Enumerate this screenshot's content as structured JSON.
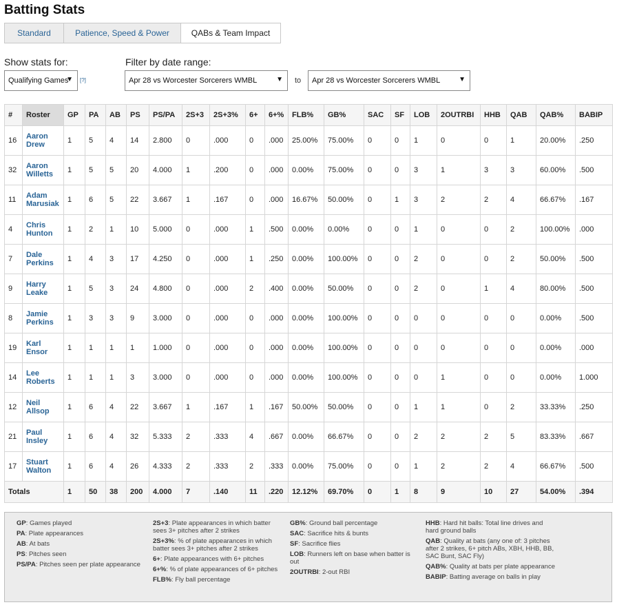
{
  "page_title": "Batting Stats",
  "tabs": [
    {
      "label": "Standard",
      "active": false
    },
    {
      "label": "Patience, Speed & Power",
      "active": false
    },
    {
      "label": "QABs & Team Impact",
      "active": true
    }
  ],
  "filters": {
    "show_stats_label": "Show stats for:",
    "show_stats_value": "Qualifying Games",
    "help_link": "[?]",
    "date_range_label": "Filter by date range:",
    "date_from": "Apr 28 vs Worcester Sorcerers WMBL",
    "to_label": "to",
    "date_to": "Apr 28 vs Worcester Sorcerers WMBL"
  },
  "table": {
    "headers": [
      "#",
      "Roster",
      "GP",
      "PA",
      "AB",
      "PS",
      "PS/PA",
      "2S+3",
      "2S+3%",
      "6+",
      "6+%",
      "FLB%",
      "GB%",
      "SAC",
      "SF",
      "LOB",
      "2OUTRBI",
      "HHB",
      "QAB",
      "QAB%",
      "BABIP"
    ],
    "rows": [
      {
        "num": "16",
        "first": "Aaron",
        "last": "Drew",
        "stats": [
          "1",
          "5",
          "4",
          "14",
          "2.800",
          "0",
          ".000",
          "0",
          ".000",
          "25.00%",
          "75.00%",
          "0",
          "0",
          "1",
          "0",
          "0",
          "1",
          "20.00%",
          ".250"
        ]
      },
      {
        "num": "32",
        "first": "Aaron",
        "last": "Willetts",
        "stats": [
          "1",
          "5",
          "5",
          "20",
          "4.000",
          "1",
          ".200",
          "0",
          ".000",
          "0.00%",
          "75.00%",
          "0",
          "0",
          "3",
          "1",
          "3",
          "3",
          "60.00%",
          ".500"
        ]
      },
      {
        "num": "11",
        "first": "Adam",
        "last": "Marusiak",
        "stats": [
          "1",
          "6",
          "5",
          "22",
          "3.667",
          "1",
          ".167",
          "0",
          ".000",
          "16.67%",
          "50.00%",
          "0",
          "1",
          "3",
          "2",
          "2",
          "4",
          "66.67%",
          ".167"
        ]
      },
      {
        "num": "4",
        "first": "Chris",
        "last": "Hunton",
        "stats": [
          "1",
          "2",
          "1",
          "10",
          "5.000",
          "0",
          ".000",
          "1",
          ".500",
          "0.00%",
          "0.00%",
          "0",
          "0",
          "1",
          "0",
          "0",
          "2",
          "100.00%",
          ".000"
        ]
      },
      {
        "num": "7",
        "first": "Dale",
        "last": "Perkins",
        "stats": [
          "1",
          "4",
          "3",
          "17",
          "4.250",
          "0",
          ".000",
          "1",
          ".250",
          "0.00%",
          "100.00%",
          "0",
          "0",
          "2",
          "0",
          "0",
          "2",
          "50.00%",
          ".500"
        ]
      },
      {
        "num": "9",
        "first": "Harry",
        "last": "Leake",
        "stats": [
          "1",
          "5",
          "3",
          "24",
          "4.800",
          "0",
          ".000",
          "2",
          ".400",
          "0.00%",
          "50.00%",
          "0",
          "0",
          "2",
          "0",
          "1",
          "4",
          "80.00%",
          ".500"
        ]
      },
      {
        "num": "8",
        "first": "Jamie",
        "last": "Perkins",
        "stats": [
          "1",
          "3",
          "3",
          "9",
          "3.000",
          "0",
          ".000",
          "0",
          ".000",
          "0.00%",
          "100.00%",
          "0",
          "0",
          "0",
          "0",
          "0",
          "0",
          "0.00%",
          ".500"
        ]
      },
      {
        "num": "19",
        "first": "Karl",
        "last": "Ensor",
        "stats": [
          "1",
          "1",
          "1",
          "1",
          "1.000",
          "0",
          ".000",
          "0",
          ".000",
          "0.00%",
          "100.00%",
          "0",
          "0",
          "0",
          "0",
          "0",
          "0",
          "0.00%",
          ".000"
        ]
      },
      {
        "num": "14",
        "first": "Lee",
        "last": "Roberts",
        "stats": [
          "1",
          "1",
          "1",
          "3",
          "3.000",
          "0",
          ".000",
          "0",
          ".000",
          "0.00%",
          "100.00%",
          "0",
          "0",
          "0",
          "1",
          "0",
          "0",
          "0.00%",
          "1.000"
        ]
      },
      {
        "num": "12",
        "first": "Neil",
        "last": "Allsop",
        "stats": [
          "1",
          "6",
          "4",
          "22",
          "3.667",
          "1",
          ".167",
          "1",
          ".167",
          "50.00%",
          "50.00%",
          "0",
          "0",
          "1",
          "1",
          "0",
          "2",
          "33.33%",
          ".250"
        ]
      },
      {
        "num": "21",
        "first": "Paul",
        "last": "Insley",
        "stats": [
          "1",
          "6",
          "4",
          "32",
          "5.333",
          "2",
          ".333",
          "4",
          ".667",
          "0.00%",
          "66.67%",
          "0",
          "0",
          "2",
          "2",
          "2",
          "5",
          "83.33%",
          ".667"
        ]
      },
      {
        "num": "17",
        "first": "Stuart",
        "last": "Walton",
        "stats": [
          "1",
          "6",
          "4",
          "26",
          "4.333",
          "2",
          ".333",
          "2",
          ".333",
          "0.00%",
          "75.00%",
          "0",
          "0",
          "1",
          "2",
          "2",
          "4",
          "66.67%",
          ".500"
        ]
      }
    ],
    "totals": {
      "label": "Totals",
      "stats": [
        "1",
        "50",
        "38",
        "200",
        "4.000",
        "7",
        ".140",
        "11",
        ".220",
        "12.12%",
        "69.70%",
        "0",
        "1",
        "8",
        "9",
        "10",
        "27",
        "54.00%",
        ".394"
      ]
    }
  },
  "legend": [
    [
      {
        "key": "GP",
        "desc": "Games played"
      },
      {
        "key": "PA",
        "desc": "Plate appearances"
      },
      {
        "key": "AB",
        "desc": "At bats"
      },
      {
        "key": "PS",
        "desc": "Pitches seen"
      },
      {
        "key": "PS/PA",
        "desc": "Pitches seen per plate appearance"
      }
    ],
    [
      {
        "key": "2S+3",
        "desc": "Plate appearances in which batter sees 3+ pitches after 2 strikes"
      },
      {
        "key": "2S+3%",
        "desc": "% of plate appearances in which batter sees 3+ pitches after 2 strikes"
      },
      {
        "key": "6+",
        "desc": "Plate appearances with 6+ pitches"
      },
      {
        "key": "6+%",
        "desc": "% of plate appearances of 6+ pitches"
      },
      {
        "key": "FLB%",
        "desc": "Fly ball percentage"
      }
    ],
    [
      {
        "key": "GB%",
        "desc": "Ground ball percentage"
      },
      {
        "key": "SAC",
        "desc": "Sacrifice hits & bunts"
      },
      {
        "key": "SF",
        "desc": "Sacrifice flies"
      },
      {
        "key": "LOB",
        "desc": "Runners left on base when batter is out"
      },
      {
        "key": "2OUTRBI",
        "desc": "2-out RBI"
      }
    ],
    [
      {
        "key": "HHB",
        "desc": "Hard hit balls: Total line drives and hard ground balls"
      },
      {
        "key": "QAB",
        "desc": "Quality at bats (any one of: 3 pitches after 2 strikes, 6+ pitch ABs, XBH, HHB, BB, SAC Bunt, SAC Fly)"
      },
      {
        "key": "QAB%",
        "desc": "Quality at bats per plate appearance"
      },
      {
        "key": "BABIP",
        "desc": "Batting average on balls in play"
      }
    ]
  ]
}
